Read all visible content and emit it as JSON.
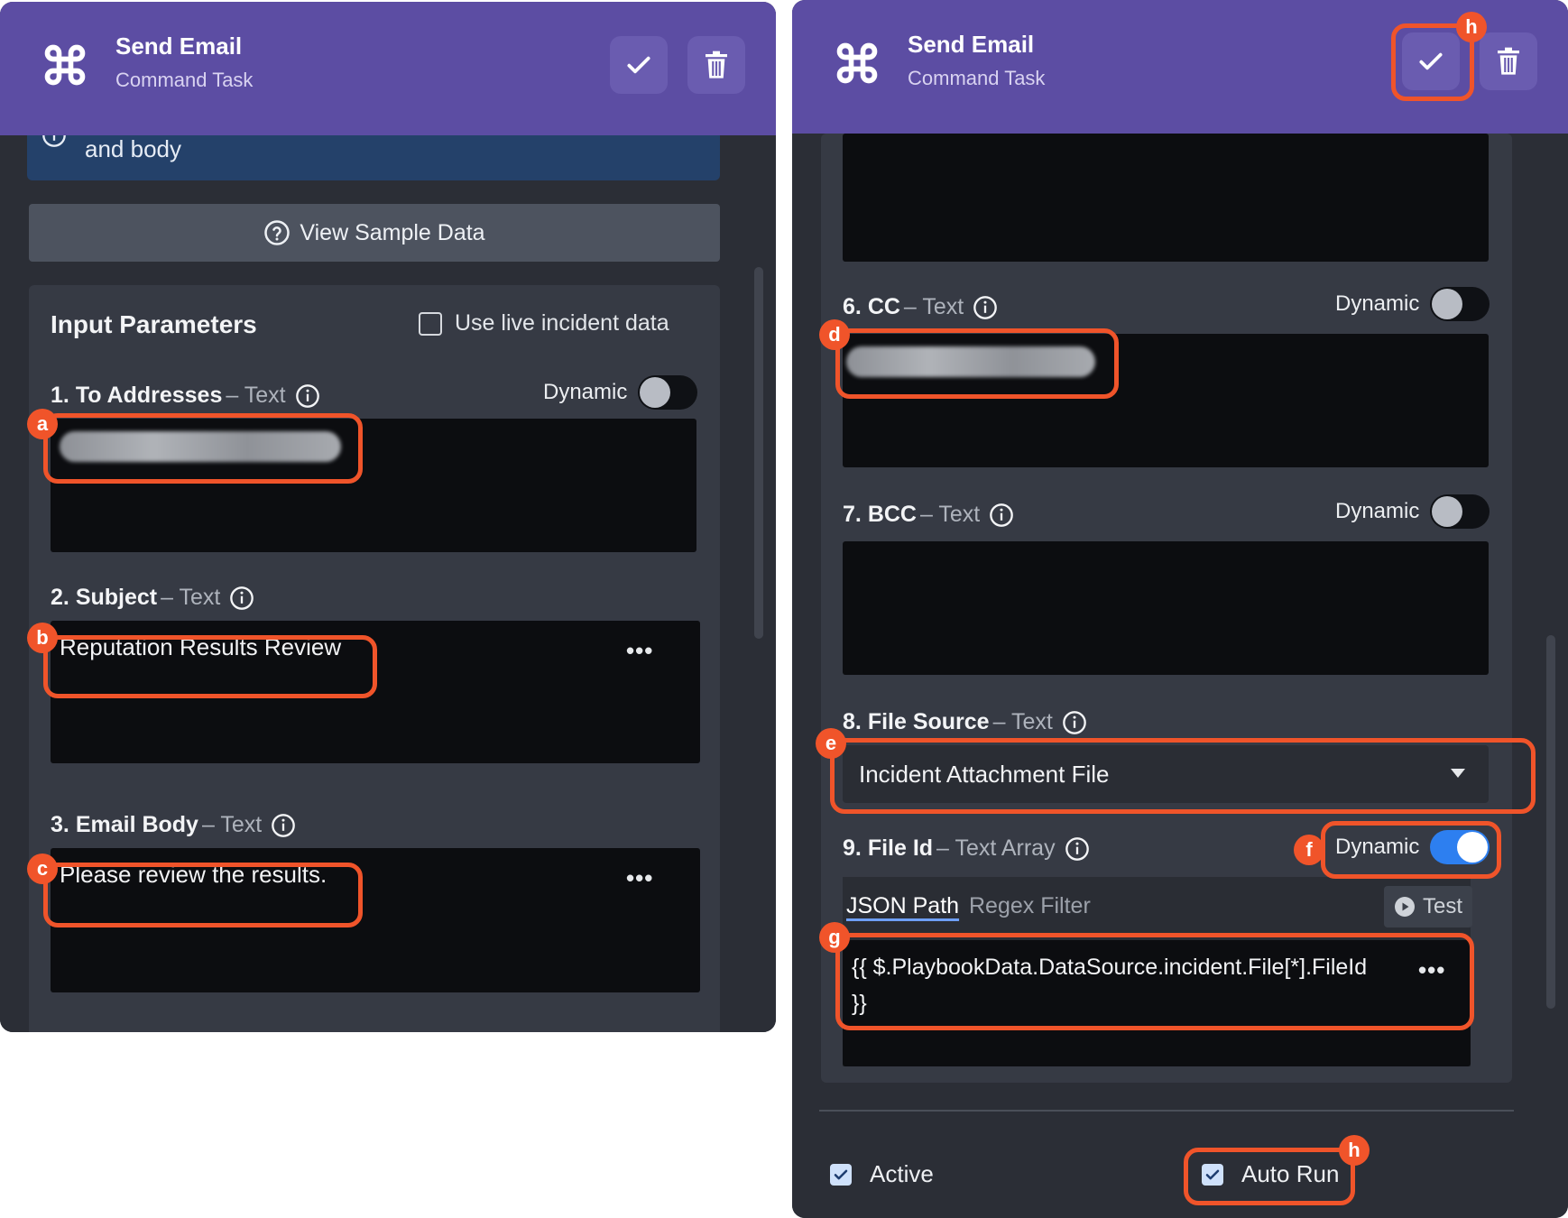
{
  "left": {
    "header": {
      "title": "Send Email",
      "subtitle": "Command Task"
    },
    "info_text": "and body",
    "sample_button": "View Sample Data",
    "params": {
      "title": "Input Parameters",
      "live_label": "Use live incident data",
      "to": {
        "num": "1.",
        "name": "To Addresses",
        "type": "– Text",
        "dynamic": "Dynamic"
      },
      "subject": {
        "num": "2.",
        "name": "Subject",
        "type": "– Text",
        "value": "Reputation Results Review"
      },
      "body": {
        "num": "3.",
        "name": "Email Body",
        "type": "– Text",
        "value": "Please review the results."
      }
    }
  },
  "right": {
    "header": {
      "title": "Send Email",
      "subtitle": "Command Task"
    },
    "cc": {
      "num": "6.",
      "name": "CC",
      "type": "– Text",
      "dynamic": "Dynamic"
    },
    "bcc": {
      "num": "7.",
      "name": "BCC",
      "type": "– Text",
      "dynamic": "Dynamic"
    },
    "file_source": {
      "num": "8.",
      "name": "File Source",
      "type": "– Text",
      "value": "Incident Attachment File"
    },
    "file_id": {
      "num": "9.",
      "name": "File Id",
      "type": "– Text Array",
      "dynamic": "Dynamic",
      "tab_json": "JSON Path",
      "tab_regex": "Regex Filter",
      "test_label": "Test",
      "value_line1": "{{ $.PlaybookData.DataSource.incident.File[*].FileId",
      "value_line2": "}}"
    },
    "footer": {
      "active_label": "Active",
      "autorun_label": "Auto Run"
    }
  },
  "more_dots": "•••",
  "badges": {
    "a": "a",
    "b": "b",
    "c": "c",
    "d": "d",
    "e": "e",
    "f": "f",
    "g": "g",
    "h": "h"
  },
  "colors": {
    "header": "#5c4da3",
    "highlight": "#f0542a",
    "panel": "#2b2e36",
    "toggle_on": "#2d7ff0"
  },
  "icons": [
    "command-icon",
    "check-icon",
    "trash-icon",
    "help-circle-icon",
    "info-icon",
    "play-icon",
    "caret-down-icon"
  ]
}
